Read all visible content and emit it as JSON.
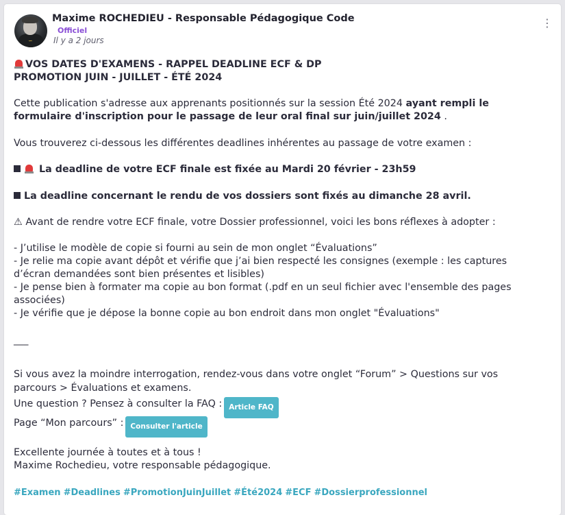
{
  "post": {
    "author": "Maxime ROCHEDIEU - Responsable Pédagogique Code",
    "badge": "Officiel",
    "time": "Il y a 2 jours",
    "menu_icon": "⋮"
  },
  "body": {
    "title1": "VOS DATES D'EXAMENS - RAPPEL DEADLINE ECF & DP",
    "title2": "PROMOTION JUIN - JUILLET - ÉTÉ 2024",
    "intro_a": "Cette publication s'adresse aux apprenants positionnés sur la session Été 2024 ",
    "intro_b": "ayant rempli le formulaire d'inscription pour le passage de leur oral final sur juin/juillet 2024",
    "intro_c": " .",
    "deadlines_intro": "Vous trouverez ci-dessous les différentes deadlines inhérentes au passage de votre examen :",
    "deadline_ecf": "La deadline de votre ECF finale est fixée au Mardi 20 février - 23h59",
    "deadline_dossier": "La deadline concernant le rendu de vos dossiers sont fixés au dimanche 28 avril.",
    "warning": "⚠ Avant de rendre votre ECF finale, votre Dossier professionnel, voici les bons réflexes à adopter :",
    "tips": [
      "- J’utilise le modèle de copie si fourni au sein de mon onglet “Évaluations”",
      "- Je relie ma copie avant dépôt et vérifie que j’ai bien respecté les consignes (exemple : les captures d’écran demandées sont bien présentes et lisibles)",
      "- Je pense bien à formater ma copie au bon format (.pdf en un seul fichier avec l'ensemble des pages associées)",
      "- Je vérifie que je dépose la bonne copie au bon endroit dans mon onglet \"Évaluations\""
    ],
    "separator": "___",
    "forum": "Si vous avez la moindre interrogation, rendez-vous dans votre onglet “Forum” > Questions sur vos parcours > Évaluations et examens.",
    "faq_text": "Une question ? Pensez à consulter la FAQ :",
    "faq_button": "Article FAQ",
    "parcours_text": "Page “Mon parcours” :",
    "parcours_button": "Consulter l'article",
    "closing1": "Excellente journée à toutes et à tous !",
    "closing2": "Maxime Rochedieu, votre responsable pédagogique."
  },
  "tags": [
    "#Examen",
    "#Deadlines",
    "#PromotionJuinJuillet",
    "#Été2024",
    "#ECF",
    "#Dossierprofessionnel"
  ],
  "colors": {
    "accent": "#4fb6c9",
    "badge": "#8a4fd6",
    "tag": "#3aa7bf"
  }
}
